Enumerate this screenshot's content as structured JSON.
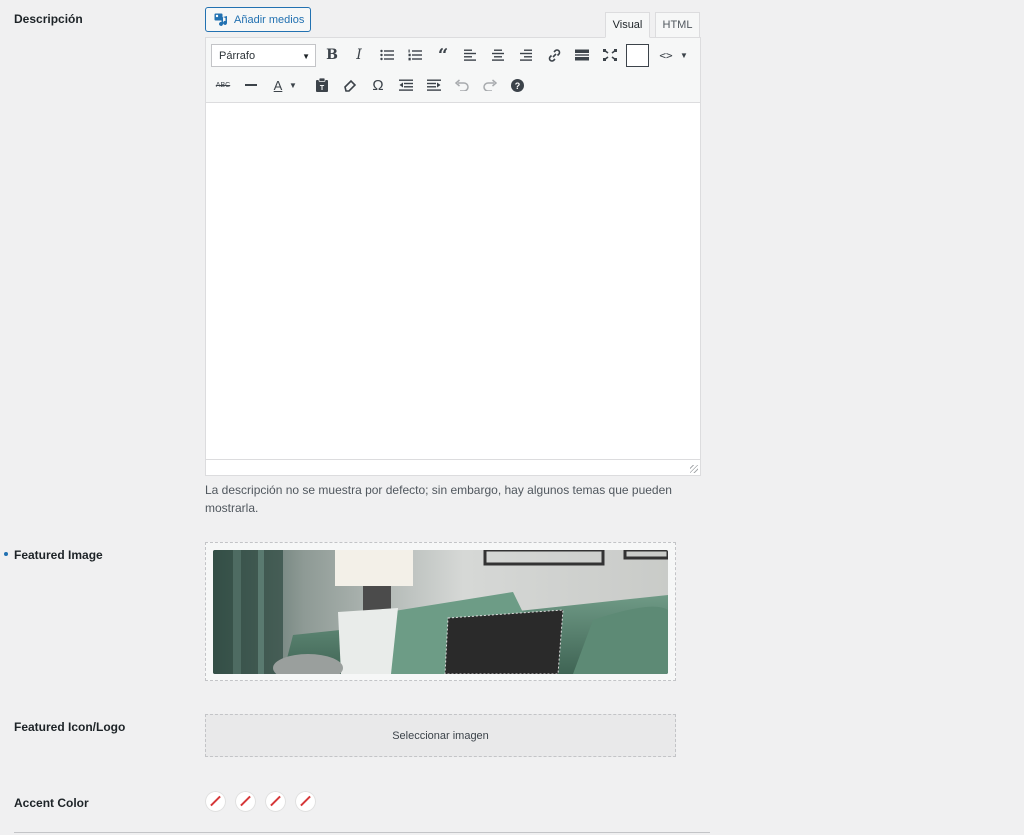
{
  "fields": {
    "description_label": "Descripción",
    "featured_image_label": "Featured Image",
    "featured_icon_label": "Featured Icon/Logo",
    "accent_color_label": "Accent Color"
  },
  "editor": {
    "add_media_label": "Añadir medios",
    "tab_visual": "Visual",
    "tab_html": "HTML",
    "format_select": "Párrafo",
    "content": ""
  },
  "help_text": "La descripción no se muestra por defecto; sin embargo, hay algunos temas que pueden mostrarla.",
  "featured_icon": {
    "select_label": "Seleccionar imagen"
  },
  "accent_colors": [
    "none",
    "none",
    "none",
    "none"
  ],
  "colors": {
    "accent": "#2271b1",
    "none_slash": "#d63638",
    "background": "#f0f0f1"
  }
}
